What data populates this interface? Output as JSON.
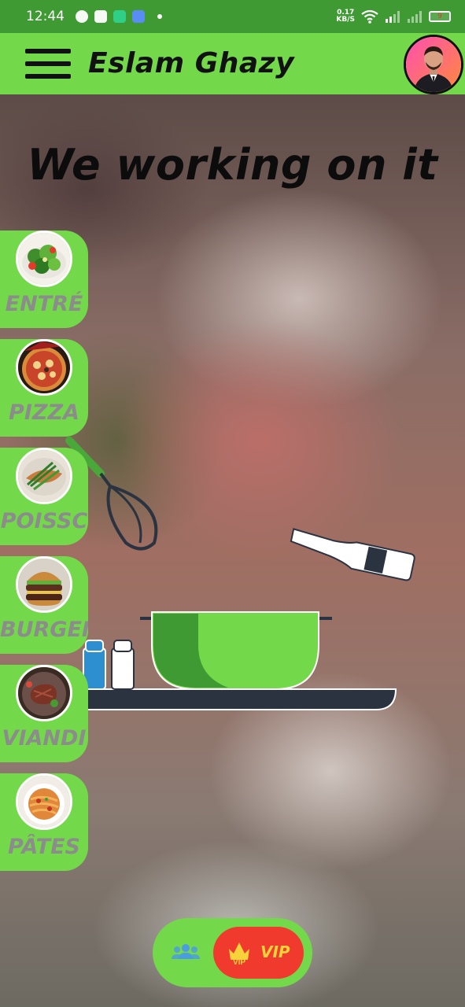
{
  "status_bar": {
    "time": "12:44",
    "speed_value": "0.17",
    "speed_unit": "KB/S",
    "battery": "9"
  },
  "app_bar": {
    "title": "Eslam Ghazy"
  },
  "main": {
    "heading": "We working on it"
  },
  "categories": [
    {
      "label": "ENTRÉ",
      "icon": "salad-image"
    },
    {
      "label": "PIZZA",
      "icon": "pizza-image"
    },
    {
      "label": "POISSC",
      "icon": "fish-image"
    },
    {
      "label": "BURGEI",
      "icon": "burger-image"
    },
    {
      "label": "VIANDI",
      "icon": "steak-image"
    },
    {
      "label": "PÂTES",
      "icon": "pasta-image"
    }
  ],
  "bottom_nav": {
    "vip_label": "VIP",
    "vip_badge": "VIP"
  },
  "colors": {
    "accent_green": "#74d94a",
    "status_green": "#3f9a33",
    "vip_red": "#f03a2e",
    "vip_gold": "#f7d23a"
  }
}
